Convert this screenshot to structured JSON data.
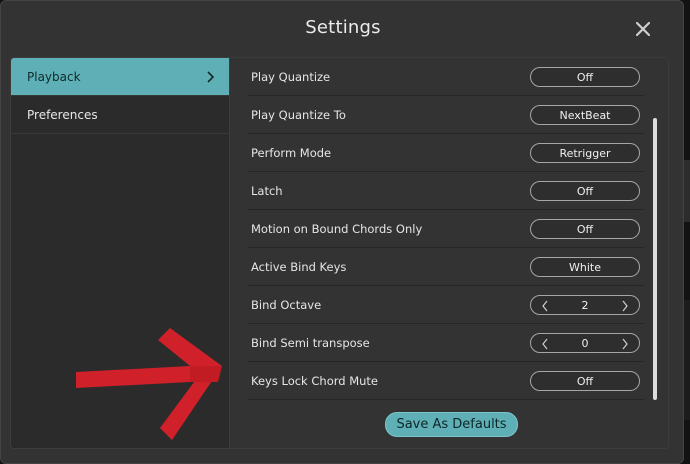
{
  "dialog": {
    "title": "Settings"
  },
  "sidebar": {
    "items": [
      {
        "label": "Playback",
        "active": true
      },
      {
        "label": "Preferences",
        "active": false
      }
    ]
  },
  "settings": {
    "rows": [
      {
        "label": "Play Quantize",
        "value": "Off",
        "control": "toggle"
      },
      {
        "label": "Play Quantize To",
        "value": "NextBeat",
        "control": "select"
      },
      {
        "label": "Perform Mode",
        "value": "Retrigger",
        "control": "select"
      },
      {
        "label": "Latch",
        "value": "Off",
        "control": "toggle"
      },
      {
        "label": "Motion on Bound Chords Only",
        "value": "Off",
        "control": "toggle"
      },
      {
        "label": "Active Bind Keys",
        "value": "White",
        "control": "select"
      },
      {
        "label": "Bind Octave",
        "value": "2",
        "control": "stepper"
      },
      {
        "label": "Bind Semi transpose",
        "value": "0",
        "control": "stepper"
      },
      {
        "label": "Keys Lock Chord Mute",
        "value": "Off",
        "control": "toggle"
      }
    ]
  },
  "footer": {
    "save_label": "Save As Defaults"
  },
  "colors": {
    "accent": "#5fb0b6",
    "annotation": "#d0202a"
  }
}
